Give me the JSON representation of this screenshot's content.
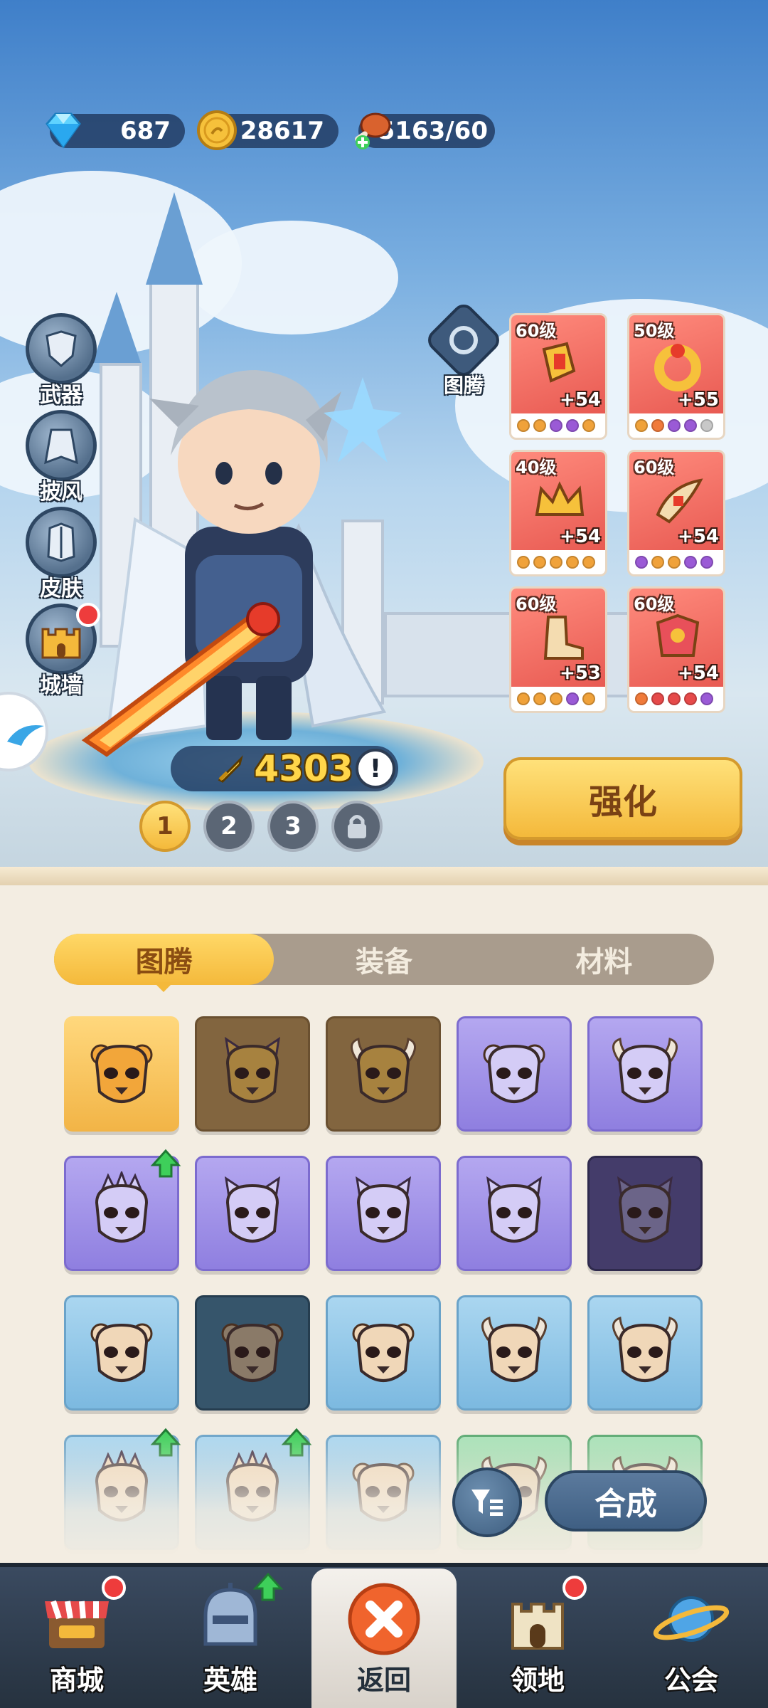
{
  "currency": {
    "gems": "687",
    "gold": "28617",
    "stamina": "5163/60"
  },
  "side_menu": [
    {
      "label": "武器",
      "icon": "weapon-armor-icon",
      "badge": false
    },
    {
      "label": "披风",
      "icon": "cape-icon",
      "badge": false
    },
    {
      "label": "皮肤",
      "icon": "skin-icon",
      "badge": false
    },
    {
      "label": "城墙",
      "icon": "castle-wall-icon",
      "badge": true
    }
  ],
  "totem_label": "图腾",
  "equipment": [
    {
      "level": "60级",
      "plus": "+54",
      "item": "gloves-icon",
      "dots": [
        "#f0a23a",
        "#f0a23a",
        "#9a5ad6",
        "#9a5ad6",
        "#f0a23a"
      ]
    },
    {
      "level": "50级",
      "plus": "+55",
      "item": "ring-icon",
      "dots": [
        "#f0a23a",
        "#f07a3a",
        "#9a5ad6",
        "#9a5ad6",
        "#c8c8c8"
      ]
    },
    {
      "level": "40级",
      "plus": "+54",
      "item": "crown-icon",
      "dots": [
        "#f0a23a",
        "#f0a23a",
        "#f0a23a",
        "#f0a23a",
        "#f0a23a"
      ]
    },
    {
      "level": "60级",
      "plus": "+54",
      "item": "horn-icon",
      "dots": [
        "#9a5ad6",
        "#f0a23a",
        "#f0a23a",
        "#9a5ad6",
        "#9a5ad6"
      ]
    },
    {
      "level": "60级",
      "plus": "+53",
      "item": "boots-icon",
      "dots": [
        "#f0a23a",
        "#f0a23a",
        "#f0a23a",
        "#9a5ad6",
        "#f0a23a"
      ]
    },
    {
      "level": "60级",
      "plus": "+54",
      "item": "armor-icon",
      "dots": [
        "#f07a3a",
        "#e64a4a",
        "#e64a4a",
        "#e64a4a",
        "#9a5ad6"
      ]
    }
  ],
  "power": "4303",
  "power_alert": "!",
  "slots": [
    "1",
    "2",
    "3"
  ],
  "enhance_label": "强化",
  "tabs": [
    {
      "label": "图腾",
      "active": true
    },
    {
      "label": "装备",
      "active": false
    },
    {
      "label": "材料",
      "active": false
    }
  ],
  "totems": [
    {
      "name": "lion-totem-icon",
      "bg": "gold"
    },
    {
      "name": "owl-totem-icon",
      "bg": "brown"
    },
    {
      "name": "bull-totem-icon",
      "bg": "brown"
    },
    {
      "name": "bear-totem-icon",
      "bg": "purple"
    },
    {
      "name": "ram-totem-icon",
      "bg": "purple"
    },
    {
      "name": "eagle-totem-icon",
      "bg": "purple",
      "upgrade": true
    },
    {
      "name": "owl-totem-icon",
      "bg": "purple"
    },
    {
      "name": "owl-totem-icon",
      "bg": "purple"
    },
    {
      "name": "cat-totem-icon",
      "bg": "purple"
    },
    {
      "name": "cat-totem-icon",
      "bg": "purple-dark"
    },
    {
      "name": "bear-skull-totem-icon",
      "bg": "blue"
    },
    {
      "name": "bear-skull-totem-icon",
      "bg": "blue-dark"
    },
    {
      "name": "bear-skull-totem-icon",
      "bg": "blue"
    },
    {
      "name": "bull-skull-totem-icon",
      "bg": "blue"
    },
    {
      "name": "bull-skull-totem-icon",
      "bg": "blue"
    },
    {
      "name": "eagle-totem-icon",
      "bg": "blue",
      "upgrade": true
    },
    {
      "name": "eagle-totem-icon",
      "bg": "blue",
      "upgrade": true
    },
    {
      "name": "bear-totem-icon",
      "bg": "blue"
    },
    {
      "name": "bull-totem-icon",
      "bg": "green"
    },
    {
      "name": "bull-totem-icon",
      "bg": "green"
    }
  ],
  "merge_label": "合成",
  "nav": [
    {
      "label": "商城",
      "icon": "shop-icon",
      "badge": true
    },
    {
      "label": "英雄",
      "icon": "hero-helmet-icon",
      "upgrade": true
    },
    {
      "label": "返回",
      "icon": "close-icon",
      "active": true
    },
    {
      "label": "领地",
      "icon": "territory-castle-icon",
      "badge": true
    },
    {
      "label": "公会",
      "icon": "guild-planet-icon",
      "badge": false
    }
  ],
  "colors": {
    "accent_gold": "#f4b93b",
    "panel_bg": "#f3ede2",
    "nav_bg": "#26323f",
    "badge_red": "#ee3c3c",
    "upgrade_green": "#3ecf5a"
  }
}
